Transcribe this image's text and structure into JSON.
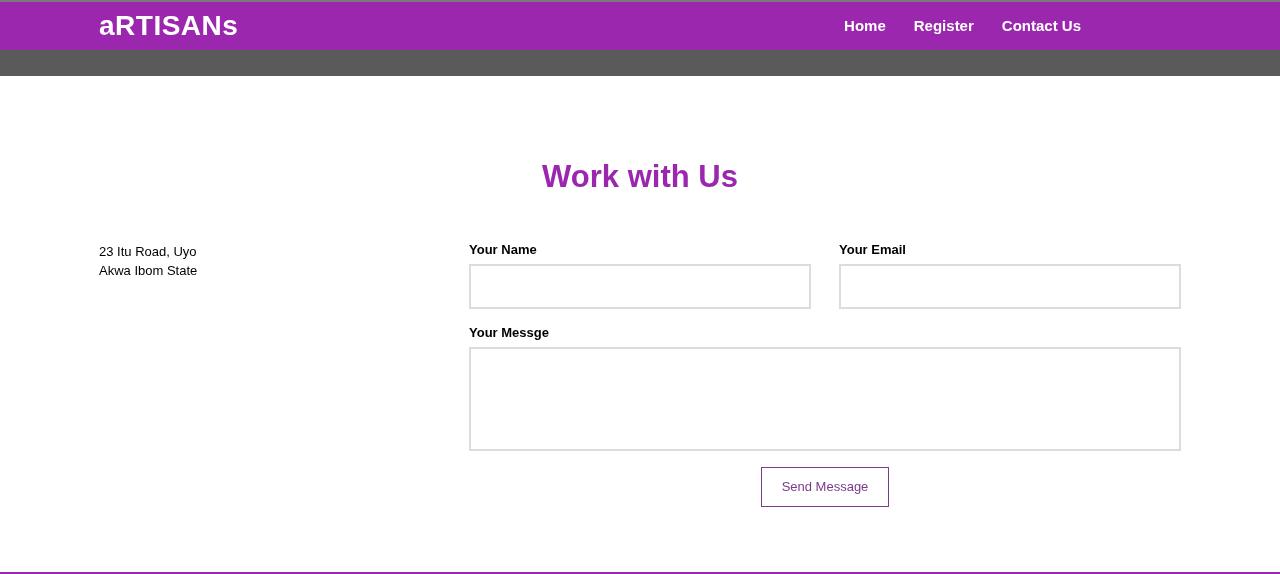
{
  "header": {
    "logo": "aRTISANs",
    "nav": [
      "Home",
      "Register",
      "Contact Us"
    ]
  },
  "title": "Work with Us",
  "address": [
    "23 Itu Road, Uyo",
    "Akwa Ibom State"
  ],
  "form": {
    "fields": [
      {
        "label": "Your Name",
        "kind": "input"
      },
      {
        "label": "Your Email",
        "kind": "input"
      },
      {
        "label": "Your Messge",
        "kind": "textarea"
      }
    ],
    "submit": "Send Message"
  }
}
